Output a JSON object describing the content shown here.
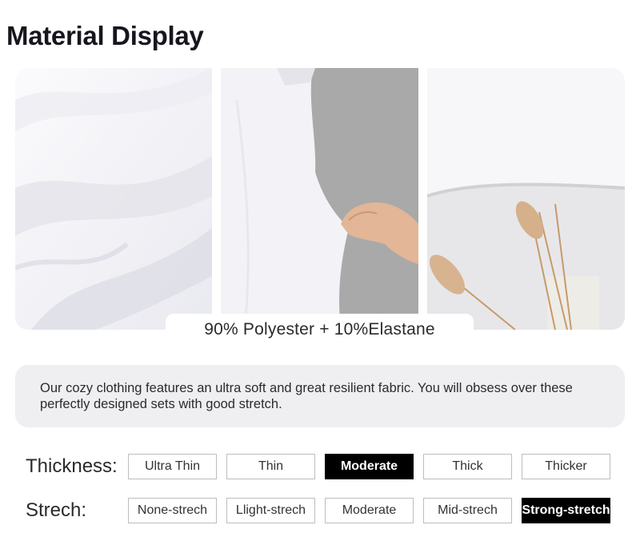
{
  "title": "Material Display",
  "caption": "90% Polyester + 10%Elastane",
  "description": "Our cozy clothing features an ultra soft and great resilient fabric. You will obsess over these perfectly designed sets with good stretch.",
  "thickness": {
    "label": "Thickness:",
    "options": [
      "Ultra Thin",
      "Thin",
      "Moderate",
      "Thick",
      "Thicker"
    ],
    "selected": "Moderate"
  },
  "stretch": {
    "label": "Strech:",
    "options": [
      "None-strech",
      "Llight-strech",
      "Moderate",
      "Mid-strech",
      "Strong-stretch"
    ],
    "selected": "Strong-stretch"
  },
  "colors": {
    "selected_bg": "#000000",
    "panel_bg": "#efeff1",
    "fabric": "#f4f4f8"
  }
}
